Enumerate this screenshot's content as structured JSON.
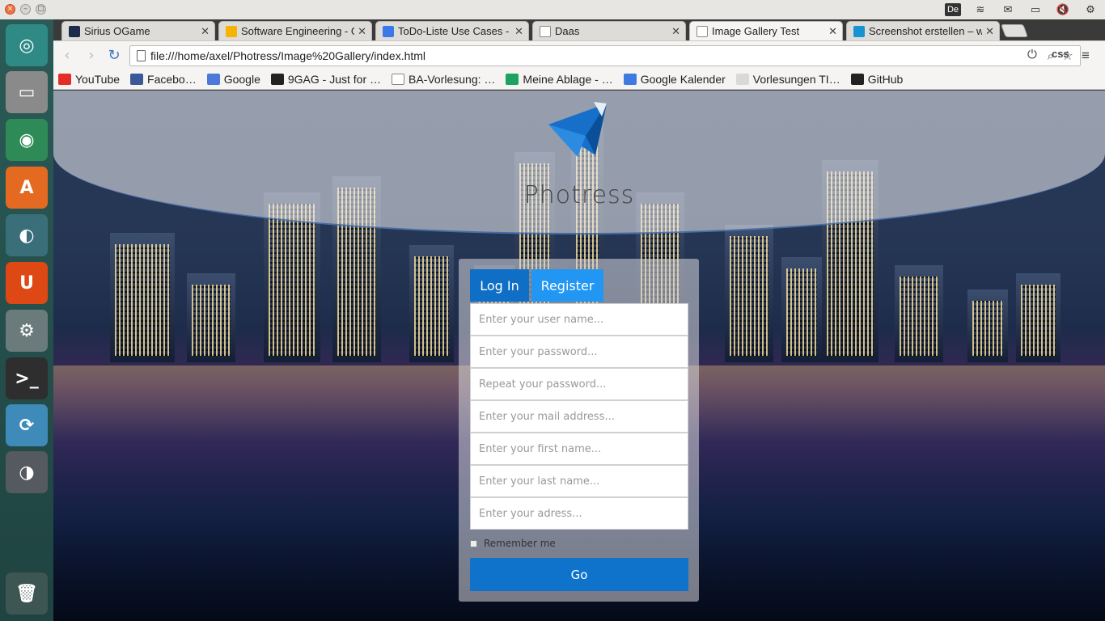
{
  "tray": {
    "lang": "De"
  },
  "tabs": [
    {
      "title": "Sirius OGame",
      "icon": "ogame-favicon",
      "active": false
    },
    {
      "title": "Software Engineering - Google",
      "icon": "google-drive-favicon",
      "active": false
    },
    {
      "title": "ToDo-Liste Use Cases - Go",
      "icon": "google-docs-favicon",
      "active": false
    },
    {
      "title": "Daas",
      "icon": "page-favicon",
      "active": false
    },
    {
      "title": "Image Gallery Test",
      "icon": "page-favicon",
      "active": true
    },
    {
      "title": "Screenshot erstellen – wiki",
      "icon": "arch-favicon",
      "active": false
    }
  ],
  "toolbar": {
    "url": "file:///home/axel/Photress/Image%20Gallery/index.html",
    "css_label": "css"
  },
  "bookmarks": [
    {
      "label": "YouTube",
      "icon": "youtube-icon",
      "color": "#e52d27"
    },
    {
      "label": "Facebo…",
      "icon": "facebook-icon",
      "color": "#3b5998"
    },
    {
      "label": "Google",
      "icon": "google-plus-icon",
      "color": "#4a79d9"
    },
    {
      "label": "9GAG - Just for …",
      "icon": "9gag-icon",
      "color": "#222222"
    },
    {
      "label": "BA-Vorlesung: …",
      "icon": "page-icon",
      "color": "#ffffff"
    },
    {
      "label": "Meine Ablage - …",
      "icon": "google-drive-icon",
      "color": "#1da261"
    },
    {
      "label": "Google Kalender",
      "icon": "calendar-icon",
      "color": "#3d7be0"
    },
    {
      "label": "Vorlesungen TI…",
      "icon": "calendar-page-icon",
      "color": "#d9d9d9"
    },
    {
      "label": "GitHub",
      "icon": "github-icon",
      "color": "#222222"
    }
  ],
  "launcher": [
    {
      "name": "ubuntu-dash-icon",
      "glyph": "◎",
      "color": "#2f8a86"
    },
    {
      "name": "files-icon",
      "glyph": "▭",
      "color": "#8a8a8a"
    },
    {
      "name": "chrome-icon",
      "glyph": "◉",
      "color": "#2e8b57"
    },
    {
      "name": "software-center-icon",
      "glyph": "A",
      "color": "#e46a21"
    },
    {
      "name": "dolphin-icon",
      "glyph": "◐",
      "color": "#3a6f7a"
    },
    {
      "name": "ubuntu-one-icon",
      "glyph": "U",
      "color": "#dd4814"
    },
    {
      "name": "settings-icon",
      "glyph": "⚙",
      "color": "#6b7b7b"
    },
    {
      "name": "terminal-icon",
      "glyph": ">_",
      "color": "#2e2e2e"
    },
    {
      "name": "sync-icon",
      "glyph": "⟳",
      "color": "#3e8ab8"
    },
    {
      "name": "steam-icon",
      "glyph": "◑",
      "color": "#555a60"
    },
    {
      "name": "trash-icon",
      "glyph": "🗑",
      "color": "#3d5553"
    }
  ],
  "page": {
    "brand": "Photress",
    "login_tab": "Log In",
    "register_tab": "Register",
    "fields": [
      "Enter your user name...",
      "Enter your password...",
      "Repeat your password...",
      "Enter your mail address...",
      "Enter your first name...",
      "Enter your last name...",
      "Enter your adress..."
    ],
    "remember_label": "Remember me",
    "go_label": "Go"
  }
}
